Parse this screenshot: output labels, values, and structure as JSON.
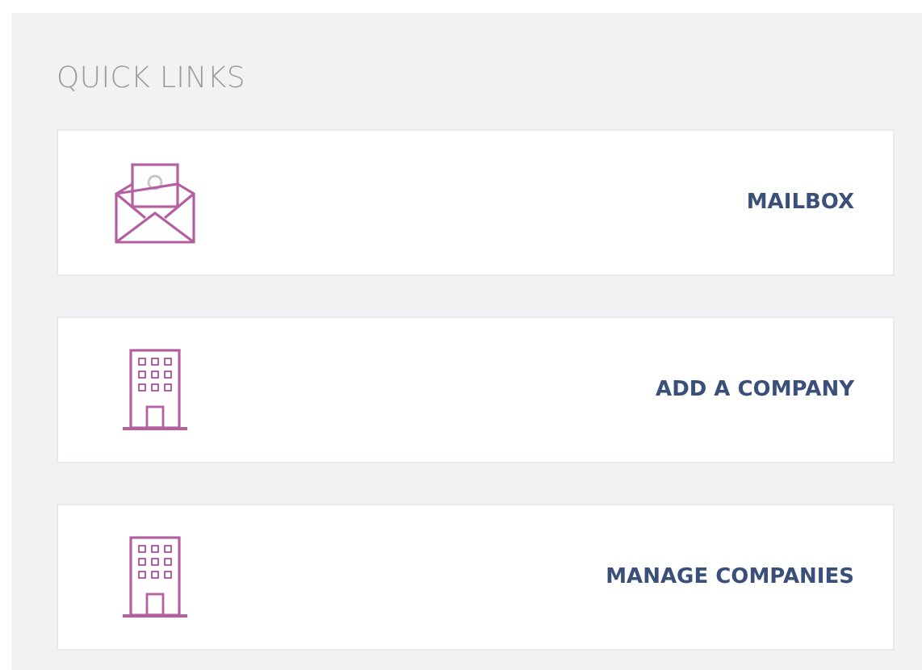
{
  "section": {
    "title": "QUICK LINKS"
  },
  "links": [
    {
      "kind": "mail",
      "label": "MAILBOX"
    },
    {
      "kind": "building",
      "label": "ADD A COMPANY"
    },
    {
      "kind": "building",
      "label": "MANAGE COMPANIES"
    }
  ]
}
